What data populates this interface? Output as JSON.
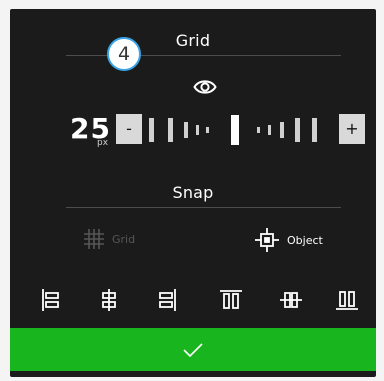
{
  "grid_section": {
    "title": "Grid",
    "step_badge": "4",
    "value": "25",
    "unit": "px",
    "decrement_label": "-",
    "increment_label": "+"
  },
  "snap_section": {
    "title": "Snap",
    "grid_option": {
      "label": "Grid",
      "enabled": false
    },
    "object_option": {
      "label": "Object",
      "enabled": true
    }
  },
  "alignment_icons": [
    "align-left-icon",
    "align-center-horizontal-icon",
    "align-right-icon",
    "align-top-icon",
    "align-center-vertical-icon",
    "align-bottom-icon"
  ],
  "confirm_icon": "checkmark-icon",
  "colors": {
    "panel": "#1b1b1b",
    "accent": "#19b51e",
    "badge_border": "#3aa4e6",
    "disabled": "#565656"
  }
}
